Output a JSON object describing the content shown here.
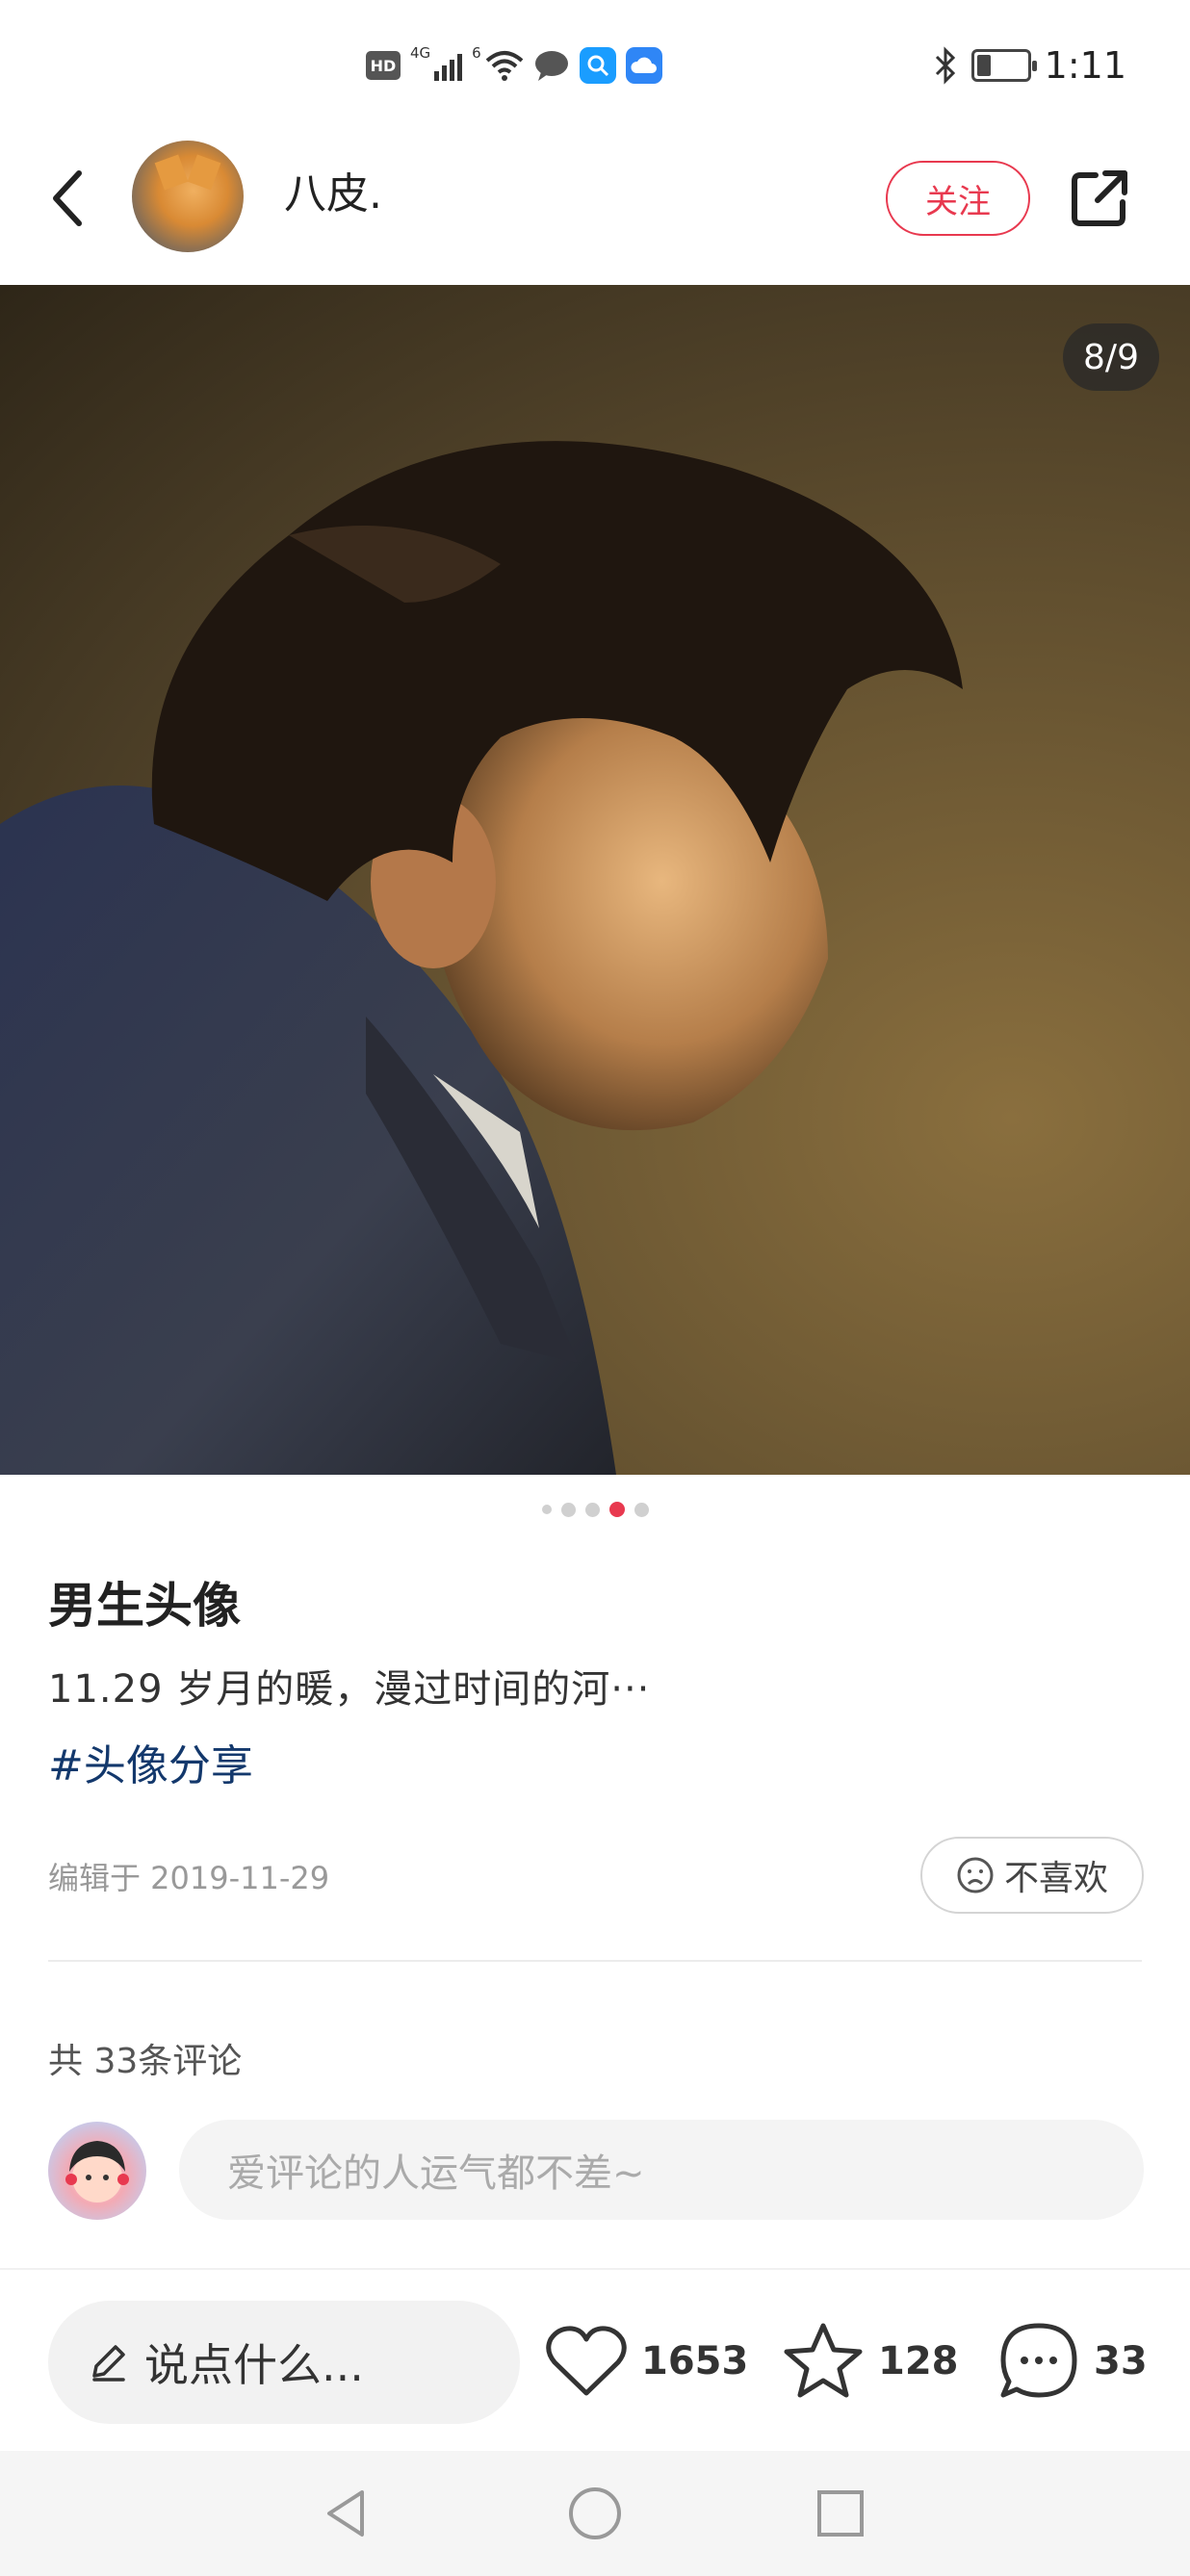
{
  "status_bar": {
    "network_label": "4G",
    "wifi_label": "6",
    "time": "1:11",
    "battery_level": 0.25,
    "hd_label": "HD"
  },
  "header": {
    "username": "八皮.",
    "follow_label": "关注",
    "icons": [
      "back-icon",
      "share-icon"
    ]
  },
  "photo": {
    "page_counter": "8/9",
    "dots_total": 5,
    "active_dot": 3
  },
  "post": {
    "title": "男生头像",
    "body": "11.29  岁月的暖，漫过时间的河···",
    "tag": "#头像分享",
    "edit_date": "编辑于 2019-11-29",
    "dislike_label": "不喜欢"
  },
  "comments": {
    "count_label": "共 33条评论",
    "input_placeholder": "爱评论的人运气都不差~"
  },
  "bottom_bar": {
    "say_label": "说点什么...",
    "likes": "1653",
    "favorites": "128",
    "comments": "33"
  },
  "nav": {
    "buttons": [
      "back-triangle-icon",
      "home-circle-icon",
      "recents-square-icon"
    ]
  },
  "colors": {
    "accent": "#e8394f",
    "tag": "#13386c"
  }
}
